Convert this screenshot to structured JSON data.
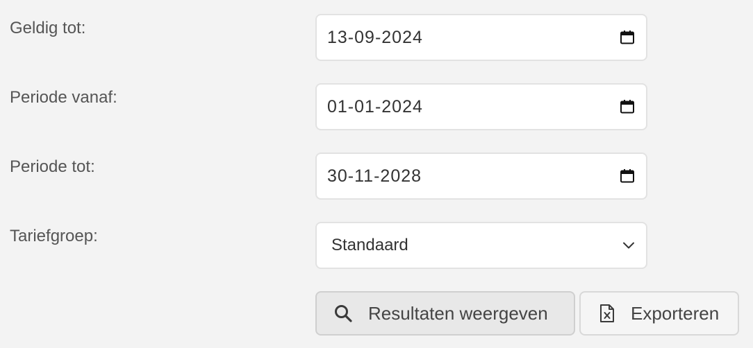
{
  "form": {
    "geldig_tot": {
      "label": "Geldig tot:",
      "value": "13-09-2024"
    },
    "periode_vanaf": {
      "label": "Periode vanaf:",
      "value": "01-01-2024"
    },
    "periode_tot": {
      "label": "Periode tot:",
      "value": "30-11-2028"
    },
    "tariefgroep": {
      "label": "Tariefgroep:",
      "selected": "Standaard"
    }
  },
  "actions": {
    "show_results_label": "Resultaten weergeven",
    "export_label": "Exporteren"
  },
  "icons": {
    "date_picker": "calendar-icon",
    "dropdown": "chevron-down-icon",
    "search": "search-icon",
    "export": "excel-file-icon"
  }
}
